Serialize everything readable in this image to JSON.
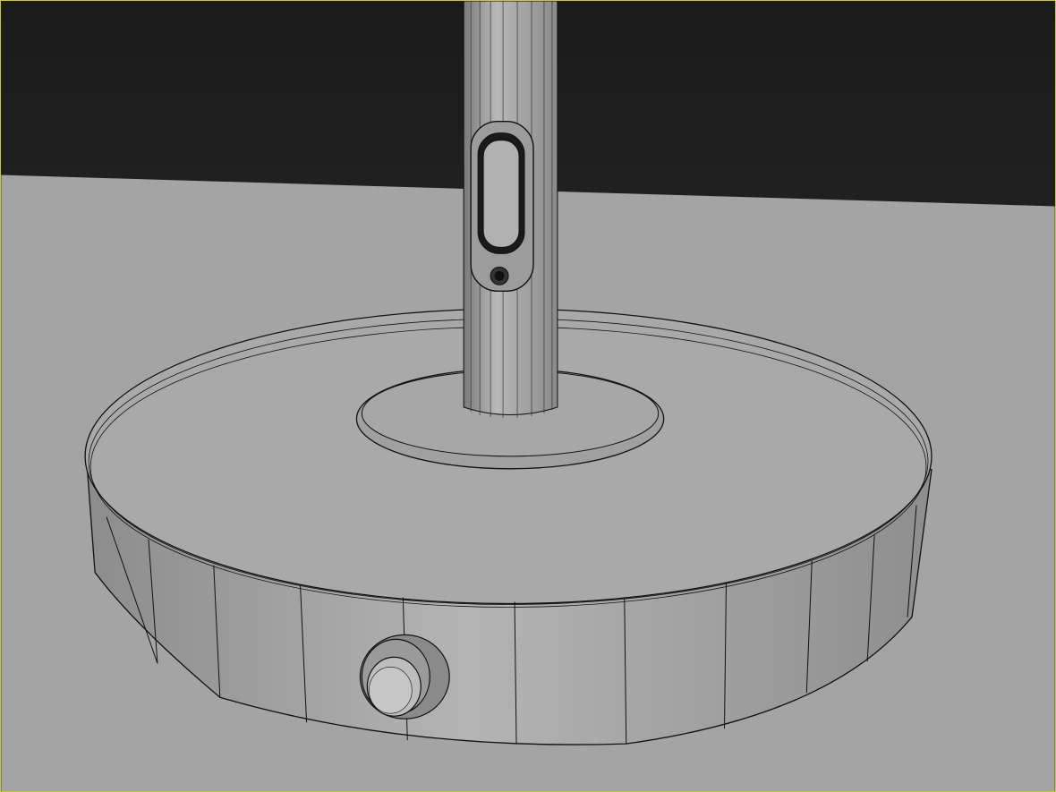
{
  "viewport": {
    "active_border_color": "#c8c832",
    "background_top": "#1b1b1b",
    "background_bottom": "#2f2f2f",
    "ground_color": "#a4a4a4",
    "model_color": "#a8a8a8",
    "wire_color": "#111111"
  }
}
